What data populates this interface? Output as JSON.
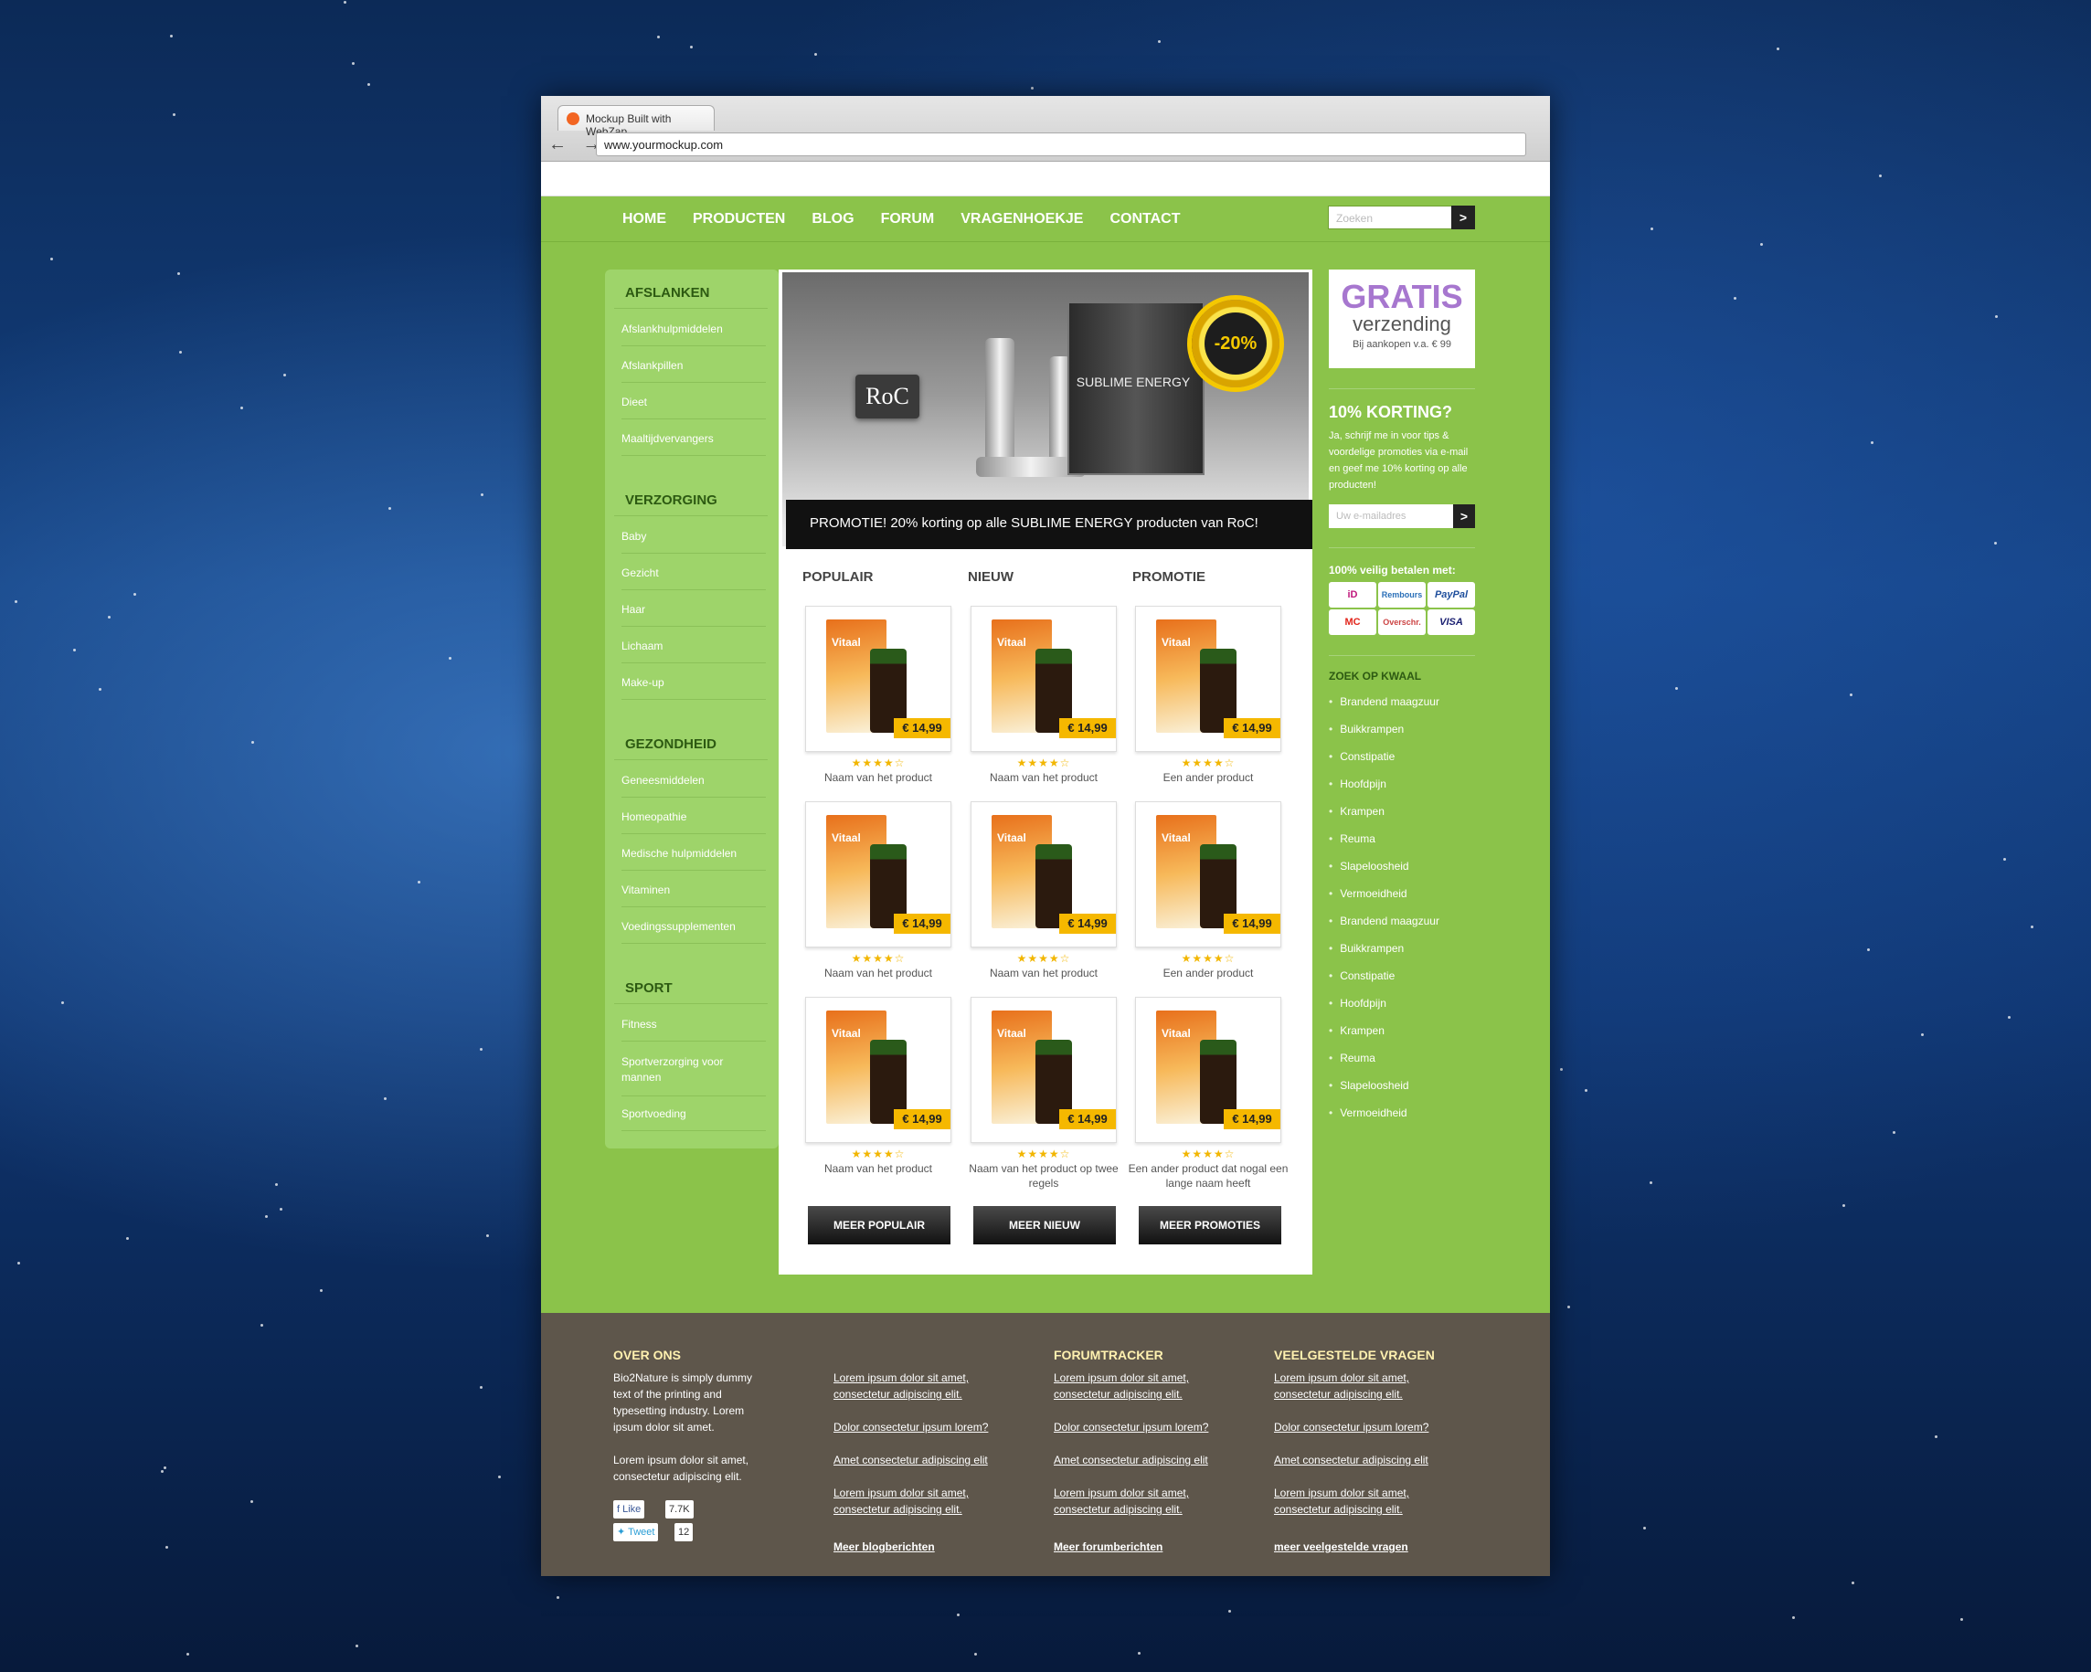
{
  "browser": {
    "tab_title": "Mockup Built with WebZap",
    "url": "www.yourmockup.com",
    "nav_glyphs": "← →"
  },
  "nav": {
    "items": [
      "HOME",
      "PRODUCTEN",
      "BLOG",
      "FORUM",
      "VRAGENHOEKJE",
      "CONTACT"
    ],
    "search_placeholder": "Zoeken",
    "search_button": ">"
  },
  "sidebar": {
    "categories": [
      {
        "title": "AFSLANKEN",
        "items": [
          "Afslankhulpmiddelen",
          "Afslankpillen",
          "Dieet",
          "Maaltijdvervangers"
        ]
      },
      {
        "title": "VERZORGING",
        "items": [
          "Baby",
          "Gezicht",
          "Haar",
          "Lichaam",
          "Make-up"
        ]
      },
      {
        "title": "GEZONDHEID",
        "items": [
          "Geneesmiddelen",
          "Homeopathie",
          "Medische hulpmiddelen",
          "Vitaminen",
          "Voedingssupplementen"
        ]
      },
      {
        "title": "SPORT",
        "items": [
          "Fitness",
          "Sportverzorging voor mannen",
          "Sportvoeding"
        ]
      }
    ]
  },
  "banner": {
    "logo": "RoC",
    "box_text": "SUBLIME ENERGY",
    "seal": "-20%",
    "caption": "PROMOTIE! 20% korting op alle SUBLIME ENERGY producten van RoC!"
  },
  "products": {
    "columns": [
      {
        "title": "POPULAIR",
        "items": [
          {
            "name": "Naam van het product",
            "price": "€ 14,99",
            "brand": "Vitaal",
            "stars": "★★★★☆",
            "rating": 4
          },
          {
            "name": "Naam van het product",
            "price": "€ 14,99",
            "brand": "Vitaal",
            "stars": "★★★★☆",
            "rating": 4
          },
          {
            "name": "Naam van het product",
            "price": "€ 14,99",
            "brand": "Vitaal",
            "stars": "★★★★☆",
            "rating": 4
          }
        ],
        "more": "MEER POPULAIR"
      },
      {
        "title": "NIEUW",
        "items": [
          {
            "name": "Naam van het product",
            "price": "€ 14,99",
            "brand": "Vitaal",
            "stars": "★★★★☆",
            "rating": 4
          },
          {
            "name": "Naam van het product",
            "price": "€ 14,99",
            "brand": "Vitaal",
            "stars": "★★★★☆",
            "rating": 4
          },
          {
            "name": "Naam van het product op twee regels",
            "price": "€ 14,99",
            "brand": "Vitaal",
            "stars": "★★★★☆",
            "rating": 4
          }
        ],
        "more": "MEER NIEUW"
      },
      {
        "title": "PROMOTIE",
        "items": [
          {
            "name": "Een ander product",
            "price": "€ 14,99",
            "brand": "Vitaal",
            "stars": "★★★★☆",
            "rating": 4
          },
          {
            "name": "Een ander product",
            "price": "€ 14,99",
            "brand": "Vitaal",
            "stars": "★★★★☆",
            "rating": 4
          },
          {
            "name": "Een ander product dat nogal een lange naam heeft",
            "price": "€ 14,99",
            "brand": "Vitaal",
            "stars": "★★★★☆",
            "rating": 4
          }
        ],
        "more": "MEER PROMOTIES"
      }
    ]
  },
  "right": {
    "gratis": {
      "big": "GRATIS",
      "mid": "verzending",
      "small": "Bij aankopen v.a. € 99"
    },
    "korting": {
      "title": "10% KORTING?",
      "text": "Ja, schrijf me in voor tips & voordelige promoties via e-mail en geef me 10% korting op alle producten!",
      "placeholder": "Uw e-mailadres",
      "button": ">"
    },
    "pay_title": "100% veilig betalen met:",
    "payments": [
      "iD",
      "Rembours",
      "PayPal",
      "MC",
      "Overschr.",
      "VISA"
    ],
    "kwaal_title": "ZOEK OP KWAAL",
    "kwaal": [
      "Brandend maagzuur",
      "Buikkrampen",
      "Constipatie",
      "Hoofdpijn",
      "Krampen",
      "Reuma",
      "Slapeloosheid",
      "Vermoeidheid",
      "Brandend maagzuur",
      "Buikkrampen",
      "Constipatie",
      "Hoofdpijn",
      "Krampen",
      "Reuma",
      "Slapeloosheid",
      "Vermoeidheid"
    ]
  },
  "footer": {
    "over": {
      "title": "OVER ONS",
      "text1": "Bio2Nature is simply dummy text of the printing and typesetting industry. Lorem ipsum dolor sit amet.",
      "text2": "Lorem ipsum dolor sit amet, consectetur adipiscing elit.",
      "like": "Like",
      "like_count": "7.7K",
      "tweet": "Tweet",
      "tweet_count": "12"
    },
    "cols": [
      {
        "title": "",
        "links": [
          "Lorem ipsum dolor sit amet, consectetur adipiscing elit.",
          "Dolor consectetur ipsum lorem?",
          "Amet consectetur adipiscing elit",
          "Lorem ipsum dolor sit amet, consectetur adipiscing elit."
        ],
        "more": "Meer blogberichten"
      },
      {
        "title": "FORUMTRACKER",
        "links": [
          "Lorem ipsum dolor sit amet, consectetur adipiscing elit.",
          "Dolor consectetur ipsum lorem?",
          "Amet consectetur adipiscing elit",
          "Lorem ipsum dolor sit amet, consectetur adipiscing elit."
        ],
        "more": "Meer forumberichten"
      },
      {
        "title": "VEELGESTELDE VRAGEN",
        "links": [
          "Lorem ipsum dolor sit amet, consectetur adipiscing elit.",
          "Dolor consectetur ipsum lorem?",
          "Amet consectetur adipiscing elit",
          "Lorem ipsum dolor sit amet, consectetur adipiscing elit."
        ],
        "more": "meer veelgestelde vragen"
      }
    ]
  }
}
